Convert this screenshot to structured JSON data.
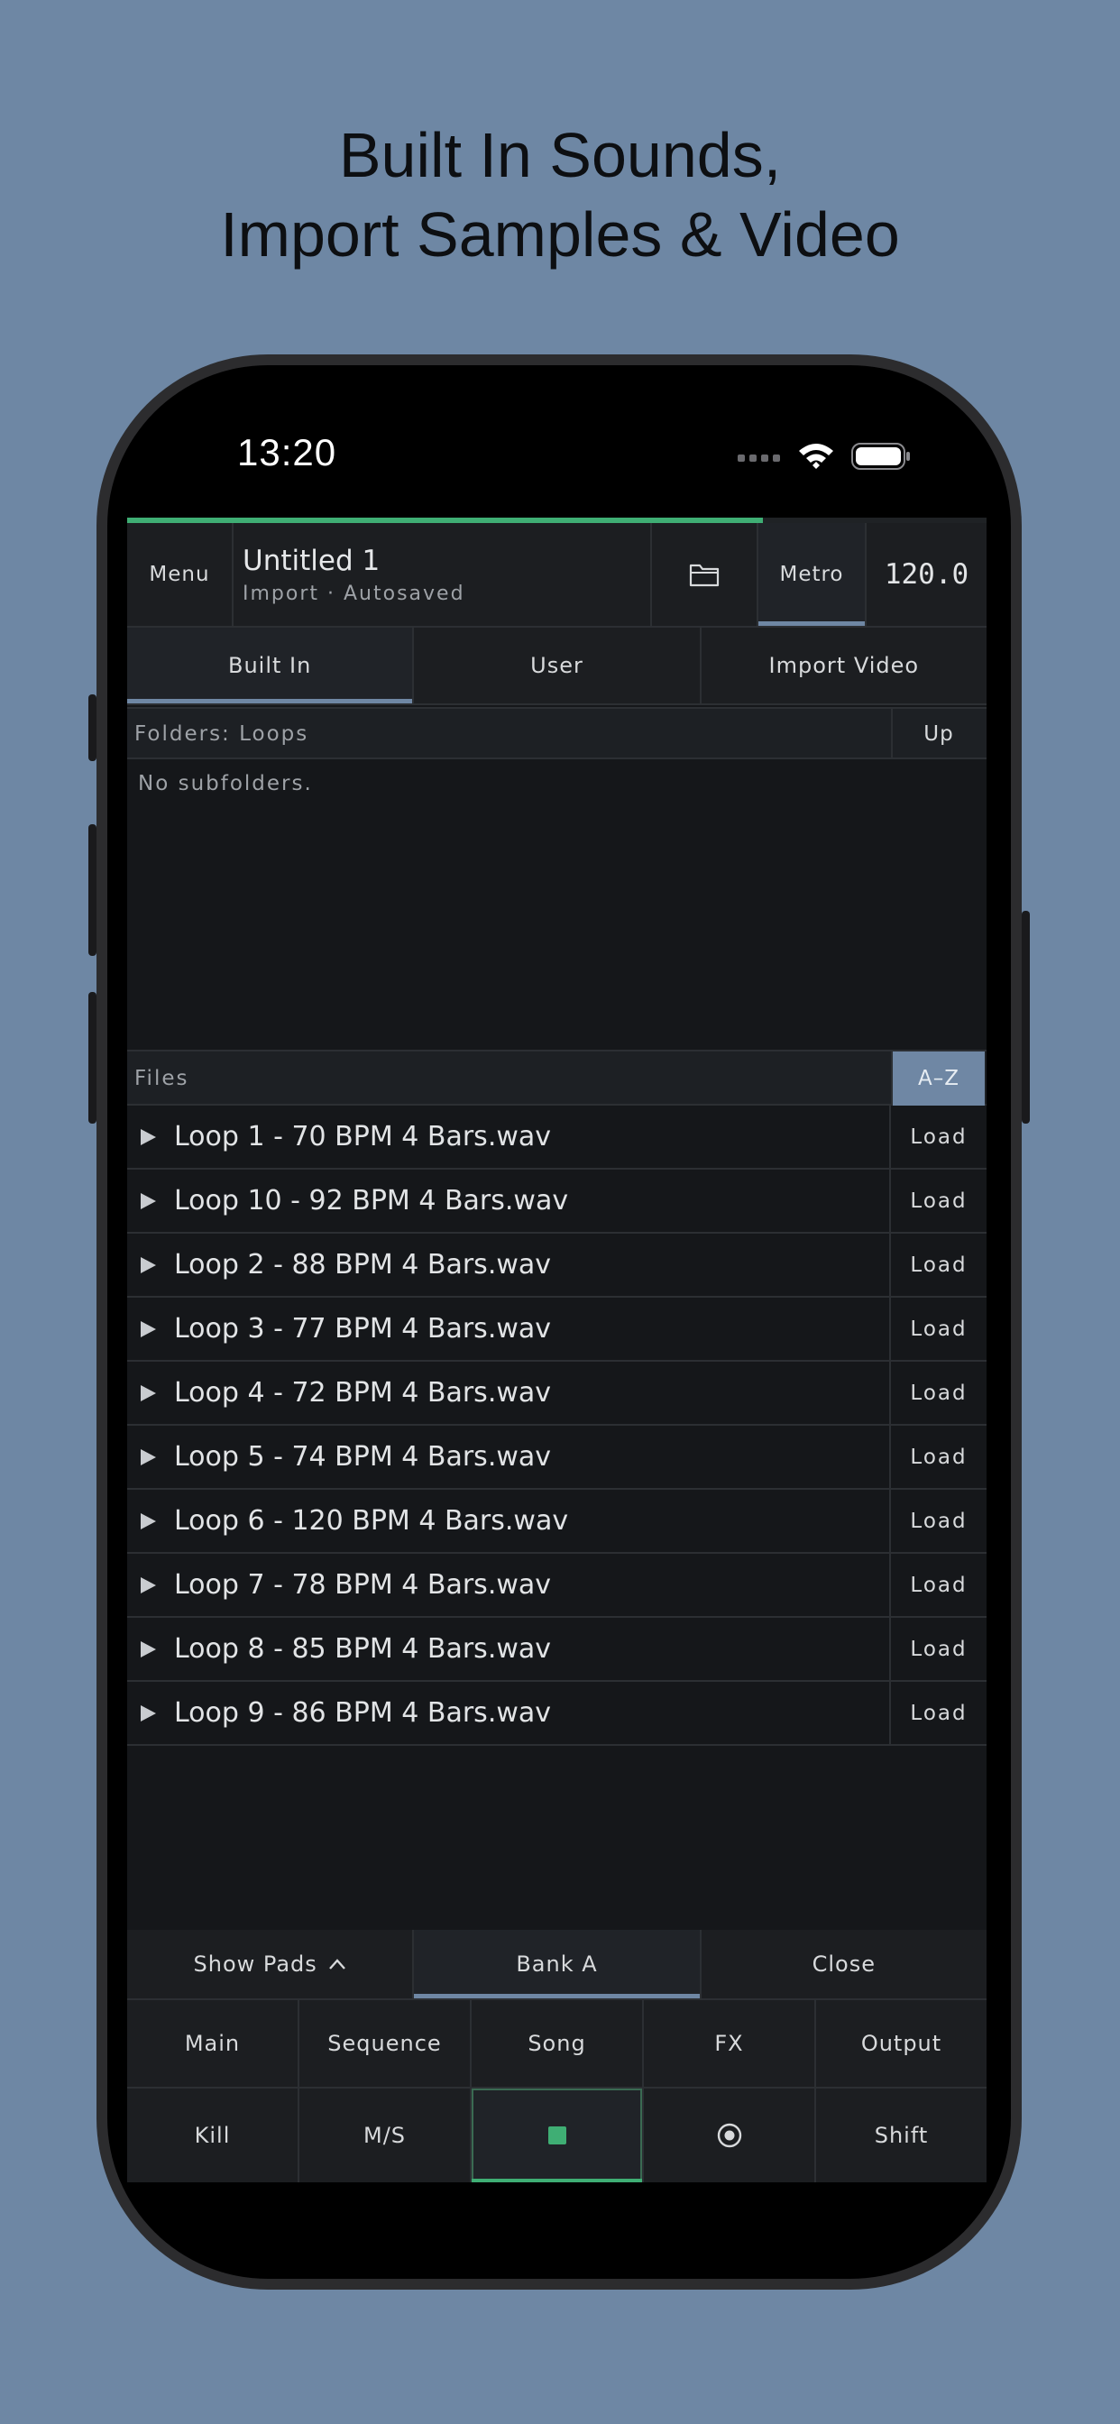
{
  "headline": {
    "line1": "Built In Sounds,",
    "line2": "Import Samples & Video"
  },
  "status": {
    "time": "13:20"
  },
  "project": {
    "menu_label": "Menu",
    "title": "Untitled 1",
    "subtitle": "Import · Autosaved",
    "metro_label": "Metro",
    "tempo": "120.0",
    "progress_fraction": 0.74
  },
  "tabs": [
    {
      "label": "Built In"
    },
    {
      "label": "User"
    },
    {
      "label": "Import Video"
    }
  ],
  "folders": {
    "header": "Folders: Loops",
    "up_label": "Up",
    "empty_text": "No subfolders."
  },
  "files": {
    "header": "Files",
    "sort_label": "A–Z",
    "load_label": "Load",
    "items": [
      "Loop 1 - 70 BPM 4 Bars.wav",
      "Loop 10 - 92 BPM 4 Bars.wav",
      "Loop 2 - 88 BPM 4 Bars.wav",
      "Loop 3 - 77 BPM 4 Bars.wav",
      "Loop 4 - 72 BPM 4 Bars.wav",
      "Loop 5 - 74 BPM 4 Bars.wav",
      "Loop 6 - 120 BPM 4 Bars.wav",
      "Loop 7 - 78 BPM 4 Bars.wav",
      "Loop 8 - 85 BPM 4 Bars.wav",
      "Loop 9 - 86 BPM 4 Bars.wav"
    ]
  },
  "pads_bar": {
    "show_pads": "Show Pads",
    "bank": "Bank A",
    "close": "Close"
  },
  "nav": [
    "Main",
    "Sequence",
    "Song",
    "FX",
    "Output"
  ],
  "transport": {
    "kill": "Kill",
    "ms": "M/S",
    "shift": "Shift"
  },
  "colors": {
    "accent_green": "#3fae74",
    "accent_blue": "#6f87a4",
    "background": "#6e87a4",
    "screen": "#15171a"
  }
}
